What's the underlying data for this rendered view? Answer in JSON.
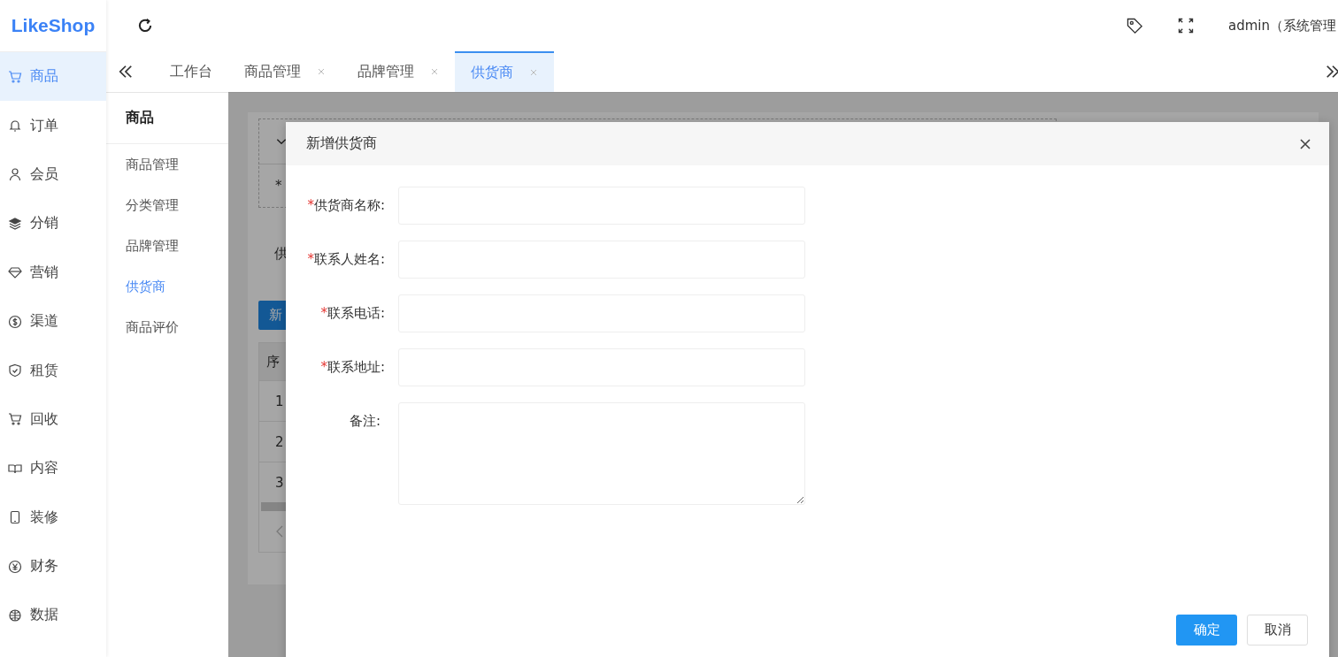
{
  "logo": {
    "text": "LikeShop"
  },
  "sidebar": {
    "items": [
      {
        "label": "商品",
        "selected": true
      },
      {
        "label": "订单",
        "selected": false
      },
      {
        "label": "会员",
        "selected": false
      },
      {
        "label": "分销",
        "selected": false
      },
      {
        "label": "营销",
        "selected": false
      },
      {
        "label": "渠道",
        "selected": false
      },
      {
        "label": "租赁",
        "selected": false
      },
      {
        "label": "回收",
        "selected": false
      },
      {
        "label": "内容",
        "selected": false
      },
      {
        "label": "装修",
        "selected": false
      },
      {
        "label": "财务",
        "selected": false
      },
      {
        "label": "数据",
        "selected": false
      }
    ]
  },
  "header": {
    "user": "admin（系统管理"
  },
  "tabs": [
    {
      "label": "工作台",
      "closable": false,
      "selected": false
    },
    {
      "label": "商品管理",
      "closable": true,
      "selected": false
    },
    {
      "label": "品牌管理",
      "closable": true,
      "selected": false
    },
    {
      "label": "供货商",
      "closable": true,
      "selected": true
    }
  ],
  "submenu": {
    "title": "商品",
    "items": [
      {
        "label": "商品管理",
        "selected": false
      },
      {
        "label": "分类管理",
        "selected": false
      },
      {
        "label": "品牌管理",
        "selected": false
      },
      {
        "label": "供货商",
        "selected": true
      },
      {
        "label": "商品评价",
        "selected": false
      }
    ]
  },
  "background": {
    "filter_mark": "*",
    "field_label": "供",
    "add_button": "新",
    "table_header": "序",
    "rows": [
      "1",
      "2",
      "3"
    ]
  },
  "dialog": {
    "title": "新增供货商",
    "fields": [
      {
        "mark": "*",
        "label": "供货商名称:",
        "kind": "input"
      },
      {
        "mark": "*",
        "label": "联系人姓名:",
        "kind": "input"
      },
      {
        "mark": "*",
        "label": "联系电话:",
        "kind": "input"
      },
      {
        "mark": "*",
        "label": "联系地址:",
        "kind": "input"
      },
      {
        "label": "备注:",
        "kind": "textarea"
      }
    ],
    "buttons": [
      {
        "label": "确定",
        "kind": "primary"
      },
      {
        "label": "取消",
        "kind": "default"
      }
    ]
  }
}
